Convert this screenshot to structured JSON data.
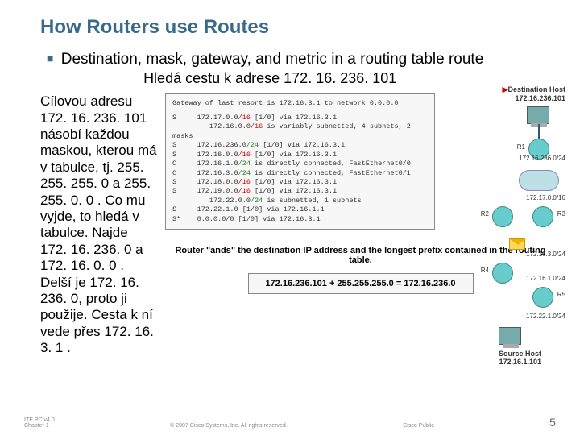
{
  "title": "How Routers use Routes",
  "bullet1": "Destination, mask, gateway, and metric in a routing table route",
  "bullet1_annotation": "Hledá cestu k adrese 172. 16. 236. 101",
  "left_text": "Cílovou adresu 172. 16. 236. 101 násobí každou maskou, kterou má v tabulce, tj. 255. 255. 255. 0 a 255. 255. 0. 0 . Co mu vyjde, to hledá v tabulce. Najde 172. 16. 236. 0 a 172. 16. 0. 0 . Delší je 172. 16. 236. 0, proto ji použije. Cesta k ní vede přes 172. 16. 3. 1 .",
  "routing_header": "Gateway of last resort is 172.16.3.1 to network 0.0.0.0",
  "routes": [
    {
      "code": "S",
      "net": "172.17.0.0",
      "mask": "/16",
      "rest": " [1/0] via 172.16.3.1"
    },
    {
      "code": "",
      "net": "172.16.0.0",
      "mask": "/16",
      "rest": " is variably subnetted, 4 subnets, 2 masks"
    },
    {
      "code": "S",
      "net": "172.16.236.0",
      "mask": "/24",
      "rest": " [1/0] via 172.16.3.1"
    },
    {
      "code": "S",
      "net": "172.16.0.0",
      "mask": "/16",
      "rest": " [1/0] via 172.16.3.1"
    },
    {
      "code": "C",
      "net": "172.16.1.0",
      "mask": "/24",
      "rest": " is directly connected, FastEthernet0/0"
    },
    {
      "code": "C",
      "net": "172.16.3.0",
      "mask": "/24",
      "rest": " is directly connected, FastEthernet0/1"
    },
    {
      "code": "S",
      "net": "172.18.0.0",
      "mask": "/16",
      "rest": " [1/0] via 172.16.3.1"
    },
    {
      "code": "S",
      "net": "172.19.0.0",
      "mask": "/16",
      "rest": " [1/0] via 172.16.3.1"
    },
    {
      "code": "",
      "net": "172.22.0.0",
      "mask": "/24",
      "rest": " is subnetted, 1 subnets"
    },
    {
      "code": "S",
      "net": "172.22.1.0",
      "mask": "",
      "rest": " [1/0] via 172.16.1.1"
    },
    {
      "code": "S*",
      "net": "0.0.0.0/0",
      "mask": "",
      "rest": " [1/0] via 172.16.3.1"
    }
  ],
  "caption": "Router \"ands\" the destination IP address and the longest prefix contained in the routing table.",
  "equation": "172.16.236.101 + 255.255.255.0 = 172.16.236.0",
  "net_labels": {
    "dest_host_t": "Destination Host",
    "dest_host_ip": "172.16.236.101",
    "r1": "R1",
    "r2": "R2",
    "r3": "R3",
    "r4": "R4",
    "r5": "R5",
    "n236": "172.16.236.0/24",
    "n172_17": "172.17.0.0/16",
    "n3": "172.16.3.0/24",
    "n1": "172.16.1.0/24",
    "n22": "172.22.1.0/24",
    "src_host_t": "Source Host",
    "src_host_ip": "172.16.1.101"
  },
  "footer": {
    "l1": "ITE PC v4.0",
    "l2": "Chapter 1",
    "c": "© 2007 Cisco Systems, Inc. All rights reserved.",
    "r": "Cisco Public",
    "pg": "5"
  }
}
